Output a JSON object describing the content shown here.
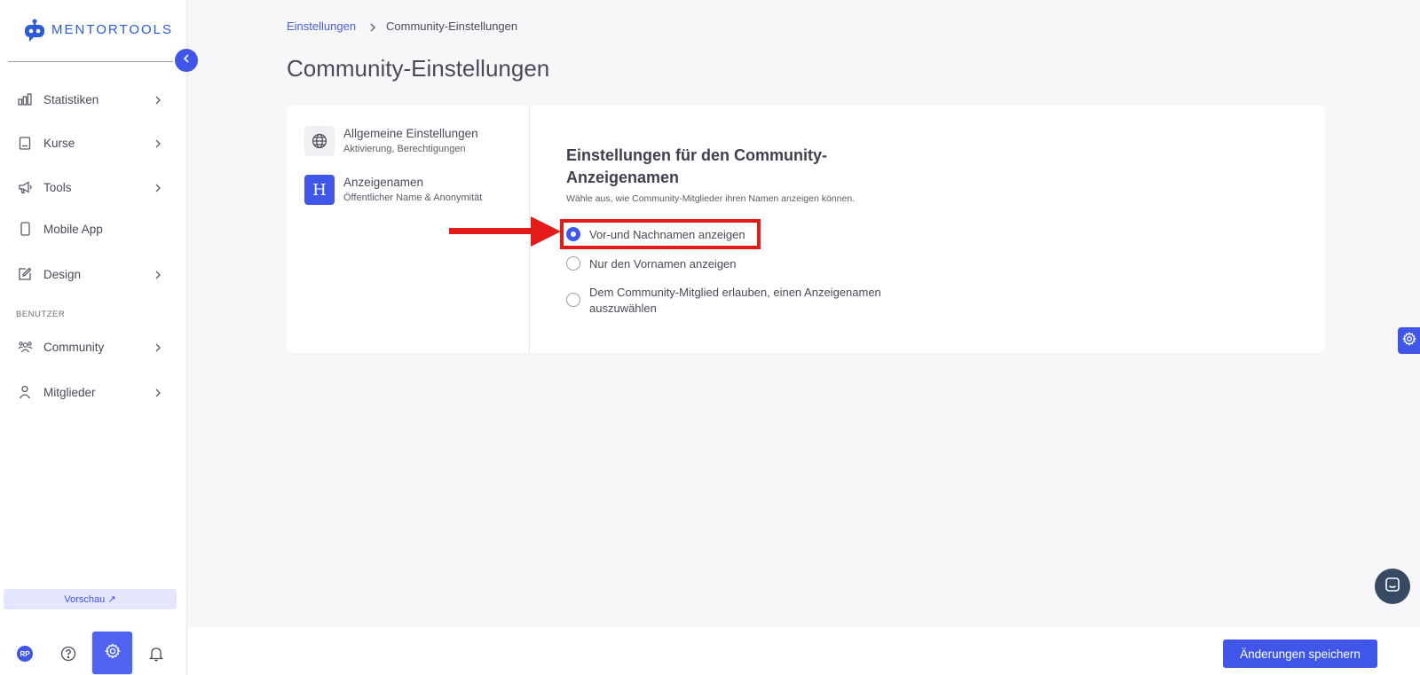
{
  "brand": {
    "name": "MENTORTOOLS",
    "color": "#2c5bd8"
  },
  "accent_color": "#3f56e9",
  "sidebar": {
    "items": [
      {
        "label": "Statistiken",
        "icon": "bar-chart-icon",
        "has_chevron": true
      },
      {
        "label": "Kurse",
        "icon": "book-icon",
        "has_chevron": true
      },
      {
        "label": "Tools",
        "icon": "megaphone-icon",
        "has_chevron": true
      },
      {
        "label": "Mobile App",
        "icon": "phone-icon",
        "has_chevron": false
      },
      {
        "label": "Design",
        "icon": "pencil-icon",
        "has_chevron": true
      }
    ],
    "section_label": "BENUTZER",
    "user_items": [
      {
        "label": "Community",
        "icon": "users-icon",
        "has_chevron": true
      },
      {
        "label": "Mitglieder",
        "icon": "person-icon",
        "has_chevron": true
      }
    ],
    "preview_label": "Vorschau ↗",
    "avatar_initials": "RP"
  },
  "breadcrumb": {
    "parent": "Einstellungen",
    "current": "Community-Einstellungen"
  },
  "page_title": "Community-Einstellungen",
  "settings_nav": [
    {
      "title": "Allgemeine Einstellungen",
      "subtitle": "Aktivierung, Berechtigungen",
      "icon": "globe-icon",
      "active": false
    },
    {
      "title": "Anzeigenamen",
      "subtitle": "Öffentlicher Name & Anonymität",
      "icon": "H",
      "active": true
    }
  ],
  "display_names": {
    "title": "Einstellungen für den Community-Anzeigenamen",
    "description": "Wähle aus, wie Community-Mitglieder ihren Namen anzeigen können.",
    "options": [
      {
        "label": "Vor-und Nachnamen anzeigen",
        "selected": true
      },
      {
        "label": "Nur den Vornamen anzeigen",
        "selected": false
      },
      {
        "label": "Dem Community-Mitglied erlauben, einen Anzeigenamen auszuwählen",
        "selected": false
      }
    ]
  },
  "save_button": "Änderungen speichern",
  "annotation_color": "#e31b1b"
}
